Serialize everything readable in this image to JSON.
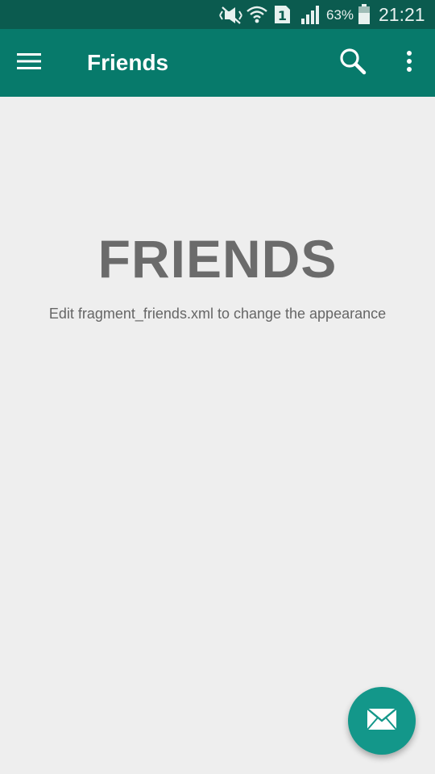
{
  "status_bar": {
    "battery_text": "63%",
    "time": "21:21",
    "sim_label": "1",
    "icons": [
      "mute-icon",
      "wifi-icon",
      "sim-icon",
      "signal-icon",
      "battery-icon"
    ]
  },
  "app_bar": {
    "title": "Friends",
    "icons": [
      "menu-icon",
      "search-icon",
      "more-vert-icon"
    ]
  },
  "content": {
    "heading": "FRIENDS",
    "subtext": "Edit fragment_friends.xml to change the appearance"
  },
  "fab": {
    "icon": "mail-icon"
  },
  "colors": {
    "status_bar": "#0b5b4f",
    "app_bar": "#077a6b",
    "background": "#eeeeee",
    "fab": "#13978a",
    "heading_text": "#6b6b6b"
  }
}
